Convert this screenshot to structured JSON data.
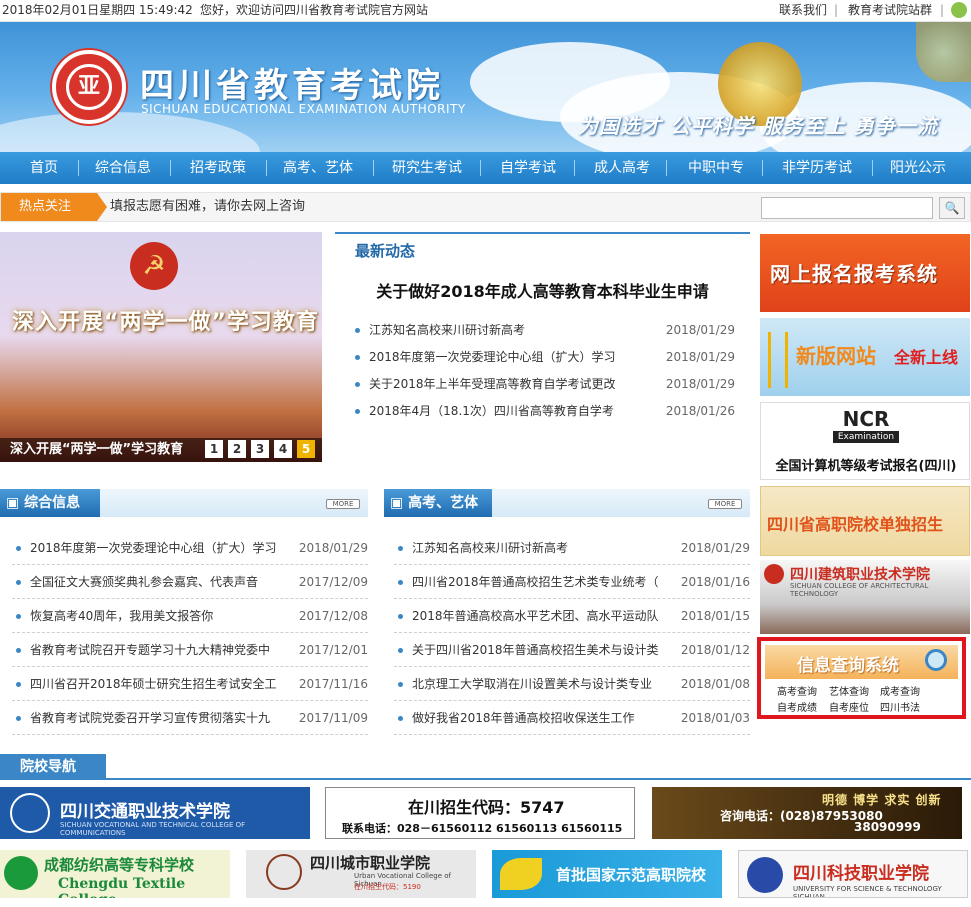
{
  "topbar": {
    "datetime": "2018年02月01日星期四 15:49:42",
    "welcome": "您好，欢迎访问四川省教育考试院官方网站",
    "contact": "联系我们",
    "separator": "|",
    "group": "教育考试院站群",
    "separator2": "|"
  },
  "banner": {
    "logo_char": "亚",
    "site_name": "四川省教育考试院",
    "site_name_en": "SICHUAN EDUCATIONAL EXAMINATION AUTHORITY",
    "slogan": "为国选才 公平科学 服务至上 勇争一流"
  },
  "nav": {
    "items": [
      "首页",
      "综合信息",
      "招考政策",
      "高考、艺体",
      "研究生考试",
      "自学考试",
      "成人高考",
      "中职中专",
      "非学历考试",
      "阳光公示"
    ]
  },
  "hot": {
    "label": "热点关注",
    "text": "填报志愿有困难，请你去网上咨询",
    "search_placeholder": "",
    "search_icon": "search-icon"
  },
  "slide": {
    "hammer": "☭",
    "headline": "深入开展“两学一做”学习教育",
    "caption": "深入开展“两学一做”学习教育",
    "pages": [
      "1",
      "2",
      "3",
      "4",
      "5"
    ],
    "active_page": "5"
  },
  "news": {
    "title": "最新动态",
    "headline": "关于做好2018年成人高等教育本科毕业生申请",
    "items": [
      {
        "title": "江苏知名高校来川研讨新高考",
        "date": "2018/01/29"
      },
      {
        "title": "2018年度第一次党委理论中心组（扩大）学习",
        "date": "2018/01/29"
      },
      {
        "title": "关于2018年上半年受理高等教育自学考试更改",
        "date": "2018/01/29"
      },
      {
        "title": "2018年4月（18.1次）四川省高等教育自学考",
        "date": "2018/01/26"
      }
    ]
  },
  "ads": {
    "ad1": "网上报名报考系统",
    "ad2_a": "新版网站",
    "ad2_b": "全新上线",
    "ad3_logo": "NCR",
    "ad3_logo_sub": "Examination",
    "ad3_text": "全国计算机等级考试报名(四川)",
    "ad4": "四川省高职院校单独招生",
    "ad5": "四川建筑职业技术学院",
    "ad5_en": "SICHUAN COLLEGE OF ARCHITECTURAL TECHNOLOGY"
  },
  "query": {
    "title": "信息查询系统",
    "links": [
      "高考查询",
      "艺体查询",
      "成考查询",
      "自考成绩",
      "自考座位",
      "四川书法"
    ]
  },
  "panel_left": {
    "title": "综合信息",
    "more": "MORE",
    "items": [
      {
        "title": "2018年度第一次党委理论中心组（扩大）学习",
        "date": "2018/01/29"
      },
      {
        "title": "全国征文大赛颁奖典礼参会嘉宾、代表声音",
        "date": "2017/12/09"
      },
      {
        "title": "恢复高考40周年，我用美文报答你",
        "date": "2017/12/08"
      },
      {
        "title": "省教育考试院召开专题学习十九大精神党委中",
        "date": "2017/12/01"
      },
      {
        "title": "四川省召开2018年硕士研究生招生考试安全工",
        "date": "2017/11/16"
      },
      {
        "title": "省教育考试院党委召开学习宣传贯彻落实十九",
        "date": "2017/11/09"
      }
    ]
  },
  "panel_right": {
    "title": "高考、艺体",
    "more": "MORE",
    "items": [
      {
        "title": "江苏知名高校来川研讨新高考",
        "date": "2018/01/29"
      },
      {
        "title": "四川省2018年普通高校招生艺术类专业统考（",
        "date": "2018/01/16"
      },
      {
        "title": "2018年普通高校高水平艺术团、高水平运动队",
        "date": "2018/01/15"
      },
      {
        "title": "关于四川省2018年普通高校招生美术与设计类",
        "date": "2018/01/12"
      },
      {
        "title": "北京理工大学取消在川设置美术与设计类专业",
        "date": "2018/01/08"
      },
      {
        "title": "做好我省2018年普通高校招收保送生工作",
        "date": "2018/01/03"
      }
    ]
  },
  "school_nav": {
    "title": "院校导航",
    "s1": "四川交通职业技术学院",
    "s1_en": "SICHUAN VOCATIONAL AND TECHNICAL COLLEGE OF COMMUNICATIONS",
    "s2_a": "在川招生代码：5747",
    "s2_b": "联系电话：028－61560112  61560113  61560115",
    "s3_a": "明德 博学 求实 创新",
    "s3_b": "咨询电话：(028)87953080",
    "s3_c": "38090999",
    "s4_a": "成都纺织高等专科学校",
    "s4_b": "Chengdu Textile College",
    "s5_a": "四川城市职业学院",
    "s5_en": "Urban Vocational College of Sichuan",
    "s5_code": "在川招生代码：5190",
    "s6": "首批国家示范高职院校",
    "s7": "四川科技职业学院",
    "s7_en": "UNIVERSITY FOR SCIENCE & TECHNOLOGY SICHUAN"
  },
  "colors": {
    "nav_blue": "#1f7cc6",
    "accent_orange": "#f08a1c",
    "query_border": "#e0161e"
  }
}
